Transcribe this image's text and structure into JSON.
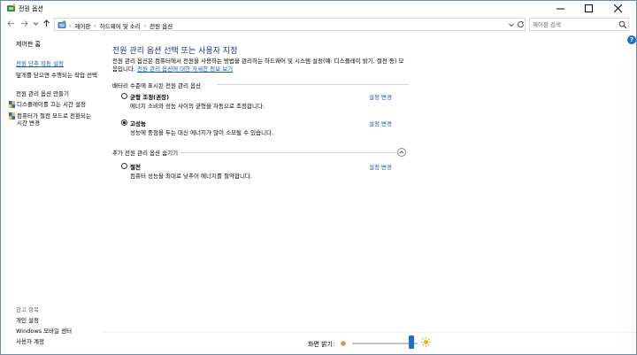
{
  "window": {
    "title": "전원 옵션"
  },
  "address": {
    "crumbs": [
      "제어판",
      "하드웨어 및 소리",
      "전원 옵션"
    ],
    "search_placeholder": "제어판 검색"
  },
  "sidebar": {
    "home": "제어판 홈",
    "links": [
      "전원 단추 작동 설정",
      "덮개를 닫으면 수행되는 작업 선택",
      "전원 관리 옵션 만들기",
      "디스플레이를 끄는 시간 설정",
      "컴퓨터가 절전 모드로 전환되는 시간 변경"
    ],
    "see_also": "참고 항목",
    "see_also_links": [
      "개인 설정",
      "Windows 모바일 센터",
      "사용자 계정"
    ]
  },
  "main": {
    "title": "전원 관리 옵션 선택 또는 사용자 지정",
    "description": "전원 관리 옵션은 컴퓨터에서 전원을 사용하는 방법을 관리하는 하드웨어 및 시스템 설정(예: 디스플레이 밝기, 절전 등) 모음입니다.",
    "description_link": "전원 관리 옵션에 대한 자세한 정보 보기",
    "battery_section": "배터리 수준에 표시된 전원 관리 옵션",
    "additional_section": "추가 전원 관리 옵션 숨기기",
    "plans": [
      {
        "name": "균형 조정(권장)",
        "desc": "에너지 소비와 성능 사이의 균형을 자동으로 조정합니다.",
        "link": "설정 변경",
        "checked": false
      },
      {
        "name": "고성능",
        "desc": "성능에 중점을 두는 대신 에너지가 많이 소모될 수 있습니다.",
        "link": "설정 변경",
        "checked": true
      },
      {
        "name": "절전",
        "desc": "컴퓨터 성능을 최대로 낮추어 에너지를 절약합니다.",
        "link": "설정 변경",
        "checked": false
      }
    ]
  },
  "brightness": {
    "label": "화면 밝기:",
    "level_fraction": 0.9
  }
}
